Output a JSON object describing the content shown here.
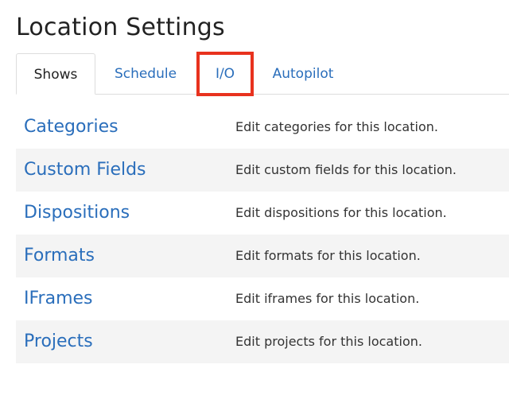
{
  "page_title": "Location Settings",
  "tabs": [
    {
      "label": "Shows",
      "active": true
    },
    {
      "label": "Schedule",
      "active": false
    },
    {
      "label": "I/O",
      "active": false,
      "highlighted": true
    },
    {
      "label": "Autopilot",
      "active": false
    }
  ],
  "rows": [
    {
      "label": "Categories",
      "description": "Edit categories for this location."
    },
    {
      "label": "Custom Fields",
      "description": "Edit custom fields for this location."
    },
    {
      "label": "Dispositions",
      "description": "Edit dispositions for this location."
    },
    {
      "label": "Formats",
      "description": "Edit formats for this location."
    },
    {
      "label": "IFrames",
      "description": "Edit iframes for this location."
    },
    {
      "label": "Projects",
      "description": "Edit projects for this location."
    }
  ],
  "colors": {
    "link": "#2a6ebb",
    "highlight_outline": "#e8321e",
    "row_alt_background": "#f4f4f4"
  }
}
